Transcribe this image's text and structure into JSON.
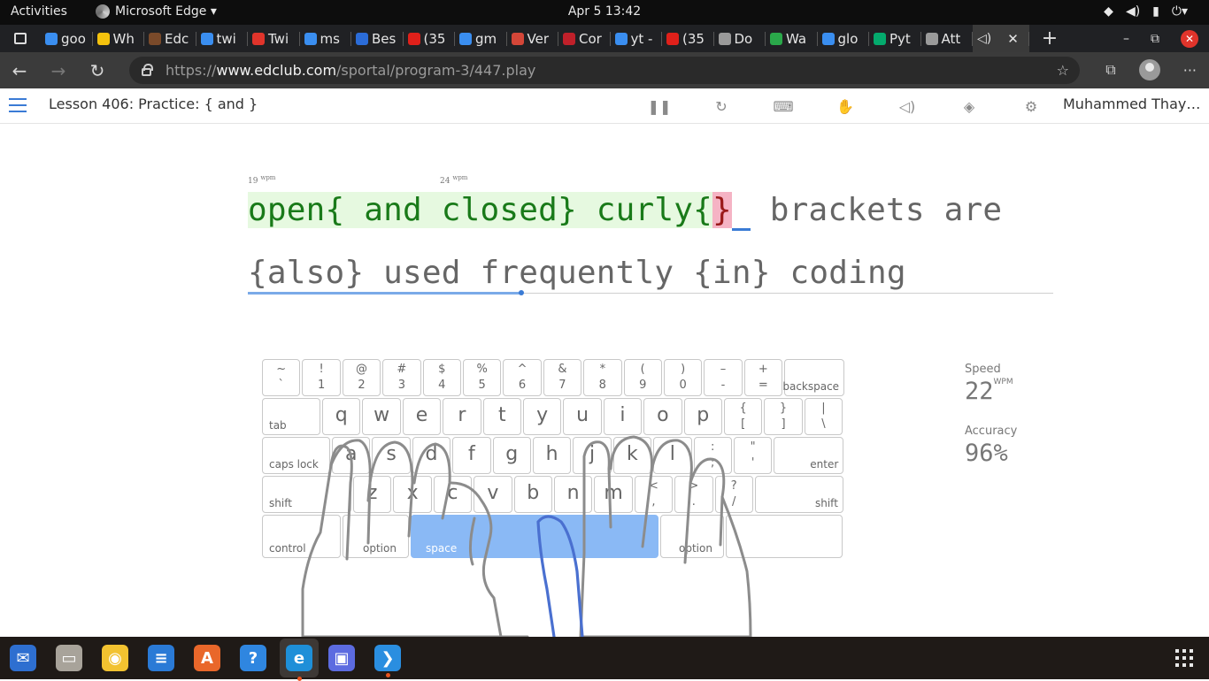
{
  "system_bar": {
    "activities": "Activities",
    "app_name": "Microsoft Edge ▾",
    "clock": "Apr 5  13:42",
    "tray": [
      "wifi-icon",
      "volume-icon",
      "battery-icon",
      "power-menu-icon"
    ]
  },
  "tabs": [
    {
      "label": "goo",
      "icon": "bing-icon",
      "color": "#3a8ef0"
    },
    {
      "label": "Wh",
      "icon": "chrome-style-icon",
      "color": "#f4c20d"
    },
    {
      "label": "Edc",
      "icon": "edclub-icon",
      "color": "#7a4a2a"
    },
    {
      "label": "twi",
      "icon": "bing-icon",
      "color": "#3a8ef0"
    },
    {
      "label": "Twi",
      "icon": "twitch-icon",
      "color": "#e0342b"
    },
    {
      "label": "ms",
      "icon": "bing-icon",
      "color": "#3a8ef0"
    },
    {
      "label": "Bes",
      "icon": "mail-icon",
      "color": "#2b6cd8"
    },
    {
      "label": "(35",
      "icon": "youtube-icon",
      "color": "#e0201a"
    },
    {
      "label": "gm",
      "icon": "bing-icon",
      "color": "#3a8ef0"
    },
    {
      "label": "Ver",
      "icon": "gmail-icon",
      "color": "#d44638"
    },
    {
      "label": "Cor",
      "icon": "opera-icon",
      "color": "#c0202a"
    },
    {
      "label": "yt -",
      "icon": "bing-icon",
      "color": "#3a8ef0"
    },
    {
      "label": "(35",
      "icon": "youtube-icon",
      "color": "#e0201a"
    },
    {
      "label": "Do",
      "icon": "doc-icon",
      "color": "#9a9a9a"
    },
    {
      "label": "Wa",
      "icon": "check-icon",
      "color": "#2aa84a"
    },
    {
      "label": "glo",
      "icon": "bing-icon",
      "color": "#3a8ef0"
    },
    {
      "label": "Pyt",
      "icon": "w3schools-icon",
      "color": "#04aa6d"
    },
    {
      "label": "Att",
      "icon": "doc-icon",
      "color": "#9a9a9a"
    }
  ],
  "address_bar": {
    "scheme": "https://",
    "host": "www.edclub.com",
    "path": "/sportal/program-3/447.play"
  },
  "lesson": {
    "title": "Lesson 406: Practice: { and }",
    "user": "Muhammed Thay…",
    "tools": [
      "pause-icon",
      "restart-icon",
      "keyboard-icon",
      "hand-icon",
      "sound-icon",
      "paint-bucket-icon",
      "settings-icon"
    ]
  },
  "typing": {
    "wpm_marker_1": "19",
    "wpm_marker_2": "24",
    "wpm_unit": "wpm",
    "typed": "open{ and closed} curly{",
    "error_char": "}",
    "remaining_line1": " brackets are",
    "line2": "{also} used frequently {in} coding",
    "progress_fraction": 0.34
  },
  "keyboard": {
    "row1": [
      [
        "~",
        "`"
      ],
      [
        "!",
        "1"
      ],
      [
        "@",
        "2"
      ],
      [
        "#",
        "3"
      ],
      [
        "$",
        "4"
      ],
      [
        "%",
        "5"
      ],
      [
        "^",
        "6"
      ],
      [
        "&",
        "7"
      ],
      [
        "*",
        "8"
      ],
      [
        "(",
        "9"
      ],
      [
        ")",
        "0"
      ],
      [
        "–",
        "-"
      ],
      [
        "+",
        "="
      ]
    ],
    "backspace": "backspace",
    "tab": "tab",
    "row2": [
      "q",
      "w",
      "e",
      "r",
      "t",
      "y",
      "u",
      "i",
      "o",
      "p"
    ],
    "row2_pairs": [
      [
        "{",
        "["
      ],
      [
        "}",
        "]"
      ],
      [
        "|",
        "\\"
      ]
    ],
    "caps_lock": "caps lock",
    "row3": [
      "a",
      "s",
      "d",
      "f",
      "g",
      "h",
      "j",
      "k",
      "l"
    ],
    "row3_pairs": [
      [
        ":",
        ";"
      ],
      [
        "\"",
        "'"
      ]
    ],
    "enter": "enter",
    "shift_left": "shift",
    "row4": [
      "z",
      "x",
      "c",
      "v",
      "b",
      "n",
      "m"
    ],
    "row4_pairs": [
      [
        "<",
        ","
      ],
      [
        ">",
        "."
      ],
      [
        "?",
        "/"
      ]
    ],
    "shift_right": "shift",
    "control": "control",
    "option_left": "option",
    "space": "space",
    "option_right": "option"
  },
  "stats": {
    "speed_label": "Speed",
    "speed_value": "22",
    "speed_unit": "WPM",
    "accuracy_label": "Accuracy",
    "accuracy_value": "96%"
  },
  "dock": [
    {
      "name": "thunderbird-icon",
      "color": "#2e6fd0",
      "glyph": "✉"
    },
    {
      "name": "files-icon",
      "color": "#a8a39a",
      "glyph": "▭"
    },
    {
      "name": "rhythmbox-icon",
      "color": "#f2c230",
      "glyph": "◉"
    },
    {
      "name": "writer-icon",
      "color": "#2a7ad6",
      "glyph": "≡"
    },
    {
      "name": "software-icon",
      "color": "#e9672a",
      "glyph": "A"
    },
    {
      "name": "help-icon",
      "color": "#2f86e0",
      "glyph": "?"
    },
    {
      "name": "edge-icon",
      "color": "#1e8fd8",
      "glyph": "e"
    },
    {
      "name": "screenshot-icon",
      "color": "#5c6be0",
      "glyph": "▣"
    },
    {
      "name": "vscode-icon",
      "color": "#2a8ee0",
      "glyph": "❯"
    }
  ]
}
